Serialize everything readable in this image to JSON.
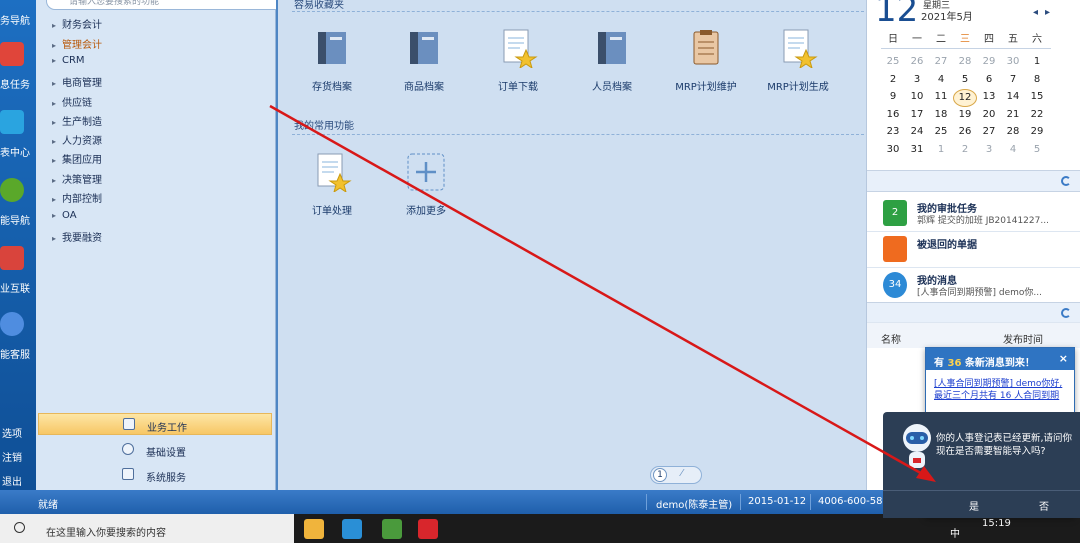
{
  "leftbar": {
    "items": [
      {
        "label": "务导航",
        "color": "#2a78d6"
      },
      {
        "label": "息任务",
        "color": "#e0453a"
      },
      {
        "label": "表中心",
        "color": "#2aa4e0"
      },
      {
        "label": "能导航",
        "color": "#5aa82a"
      },
      {
        "label": "业互联",
        "color": "#d9443c"
      },
      {
        "label": "能客服",
        "color": "#4f8de0"
      }
    ],
    "bottom": [
      "选项",
      "注销",
      "退出"
    ]
  },
  "navtree": {
    "search_placeholder": "请输入您要搜索的功能",
    "items": [
      {
        "label": "财务会计",
        "active": false
      },
      {
        "label": "管理会计",
        "active": true
      },
      {
        "label": "CRM",
        "active": false
      },
      {
        "label": "电商管理",
        "active": false
      },
      {
        "label": "供应链",
        "active": false
      },
      {
        "label": "生产制造",
        "active": false
      },
      {
        "label": "人力资源",
        "active": false
      },
      {
        "label": "集团应用",
        "active": false
      },
      {
        "label": "决策管理",
        "active": false
      },
      {
        "label": "内部控制",
        "active": false
      },
      {
        "label": "OA",
        "active": false
      },
      {
        "label": "我要融资",
        "active": false
      }
    ],
    "bottom": [
      {
        "label": "业务工作",
        "active": true
      },
      {
        "label": "基础设置",
        "active": false
      },
      {
        "label": "系统服务",
        "active": false
      }
    ]
  },
  "main": {
    "section1_title": "容易收藏夹",
    "tiles1": [
      {
        "label": "存货档案",
        "icon": "book-icon"
      },
      {
        "label": "商品档案",
        "icon": "book-icon"
      },
      {
        "label": "订单下载",
        "icon": "document-star-icon"
      },
      {
        "label": "人员档案",
        "icon": "book-icon"
      },
      {
        "label": "MRP计划维护",
        "icon": "clipboard-icon"
      },
      {
        "label": "MRP计划生成",
        "icon": "document-star-icon"
      }
    ],
    "section2_title": "我的常用功能",
    "tiles2": [
      {
        "label": "订单处理",
        "icon": "document-star-icon"
      },
      {
        "label": "添加更多",
        "icon": "plus-icon"
      }
    ],
    "page": "1"
  },
  "calendar": {
    "day": "12",
    "weekday": "星期三",
    "year_month": "2021年5月",
    "headers": [
      "日",
      "一",
      "二",
      "三",
      "四",
      "五",
      "六"
    ],
    "rows": [
      [
        "25",
        "26",
        "27",
        "28",
        "29",
        "30",
        "1"
      ],
      [
        "2",
        "3",
        "4",
        "5",
        "6",
        "7",
        "8"
      ],
      [
        "9",
        "10",
        "11",
        "12",
        "13",
        "14",
        "15"
      ],
      [
        "16",
        "17",
        "18",
        "19",
        "20",
        "21",
        "22"
      ],
      [
        "23",
        "24",
        "25",
        "26",
        "27",
        "28",
        "29"
      ],
      [
        "30",
        "31",
        "1",
        "2",
        "3",
        "4",
        "5"
      ]
    ],
    "selected": "12"
  },
  "tasks": [
    {
      "title": "我的审批任务",
      "sub": "郭辉  提交的加班 JB20141227...",
      "badge": "2",
      "color": "#2ea043"
    },
    {
      "title": "被退回的单据",
      "sub": "",
      "badge": "",
      "color": "#ef6b1f"
    },
    {
      "title": "我的消息",
      "sub": "[人事合同到期预警] demo你...",
      "badge": "34",
      "color": "#2d8ad6"
    }
  ],
  "list_headers": {
    "name": "名称",
    "time": "发布时间"
  },
  "statusbar": {
    "ready": "就绪",
    "user": "demo(陈泰主管)",
    "date": "2015-01-12",
    "phone": "4006-600-588"
  },
  "taskbar": {
    "search_text": "在这里输入你要搜索的内容",
    "time": "15:19",
    "lang": "中"
  },
  "popup": {
    "prefix": "有",
    "count": "36",
    "suffix": "条新消息到来！",
    "close": "×",
    "link": "[人事合同到期预警] demo你好,最近三个月共有 16 人合同到期"
  },
  "assistant": {
    "message": "你的人事登记表已经更新,请问你现在是否需要智能导入吗?",
    "yes": "是",
    "no": "否"
  }
}
